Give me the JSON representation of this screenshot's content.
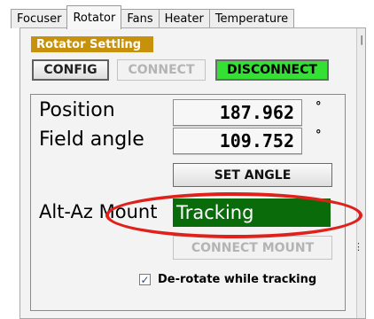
{
  "tabs": [
    "Focuser",
    "Rotator",
    "Fans",
    "Heater",
    "Temperature"
  ],
  "active_tab": "Rotator",
  "rotator": {
    "settling_label": "Rotator Settling",
    "config_label": "CONFIG",
    "connect_label": "CONNECT",
    "disconnect_label": "DISCONNECT",
    "position_label": "Position",
    "position_value": "187.962",
    "field_angle_label": "Field angle",
    "field_angle_value": "109.752",
    "degree_symbol": "°",
    "set_angle_label": "SET ANGLE",
    "mount_label": "Alt-Az Mount",
    "mount_status": "Tracking",
    "connect_mount_label": "CONNECT MOUNT",
    "derotate_label": "De-rotate while tracking",
    "derotate_checked": true
  },
  "colors": {
    "settling_bg": "#c8910c",
    "disconnect_bg": "#33e033",
    "tracking_bg": "#0a6b0a",
    "highlight_ellipse": "#e0201a"
  }
}
